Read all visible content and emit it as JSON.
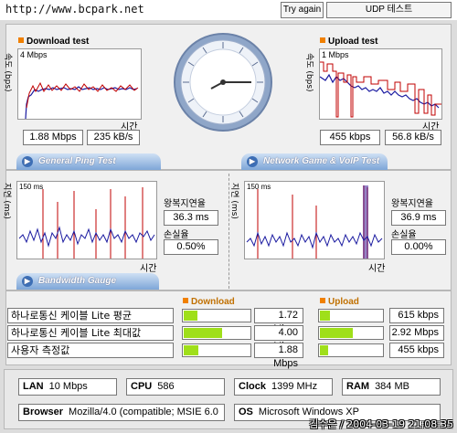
{
  "watermark": "http://www.bcpark.net",
  "header": {
    "try_again": "Try again",
    "udp_test": "UDP 테스트"
  },
  "download": {
    "title": "Download test",
    "y_axis": "속도 (bps)",
    "scale": "4 Mbps",
    "x_axis": "시간",
    "mbps": "1.88 Mbps",
    "kbs": "235 kB/s"
  },
  "upload": {
    "title": "Upload test",
    "y_axis": "속도 (bps)",
    "scale": "1 Mbps",
    "x_axis": "시간",
    "kbps": "455 kbps",
    "kbs": "56.8 kB/s"
  },
  "tabs": {
    "ping": "General Ping Test",
    "game": "Network Game & VoIP Test",
    "gauge": "Bandwidth Gauge"
  },
  "ping": {
    "y_axis": "지연 (ms)",
    "scale": "150 ms",
    "x_axis": "시간",
    "delay_label": "왕복지연율",
    "delay": "36.3 ms",
    "loss_label": "손실율",
    "loss": "0.50%"
  },
  "game": {
    "y_axis": "지연 (ms)",
    "scale": "150 ms",
    "x_axis": "시간",
    "delay_label": "왕복지연율",
    "delay": "36.9 ms",
    "loss_label": "손실율",
    "loss": "0.00%"
  },
  "gauge": {
    "download_header": "Download",
    "upload_header": "Upload",
    "rows": [
      {
        "label": "하나로통신 케이블 Lite 평균",
        "download": "1.72 Mbps",
        "download_fill": 0.23,
        "upload": "615 kbps",
        "upload_fill": 0.18
      },
      {
        "label": "하나로통신 케이블 Lite 최대값",
        "download": "4.00 Mbps",
        "download_fill": 0.64,
        "upload": "2.92 Mbps",
        "upload_fill": 0.58
      },
      {
        "label": "사용자 측정값",
        "download": "1.88 Mbps",
        "download_fill": 0.25,
        "upload": "455 kbps",
        "upload_fill": 0.14
      }
    ]
  },
  "system": {
    "lan_label": "LAN",
    "lan": "10 Mbps",
    "cpu_label": "CPU",
    "cpu": "586",
    "clock_label": "Clock",
    "clock": "1399 MHz",
    "ram_label": "RAM",
    "ram": "384 MB",
    "browser_label": "Browser",
    "browser": "Mozilla/4.0 (compatible; MSIE 6.0",
    "os_label": "OS",
    "os": "Microsoft Windows XP"
  },
  "credit": "김수은 / 2004-03-19 21:08:35",
  "colors": {
    "series_blue": "#1a1aa0",
    "series_red": "#c00000",
    "gauge_green": "#9fdf1a",
    "tab_blue": "#7ea6d8",
    "accent_orange": "#f08000"
  }
}
